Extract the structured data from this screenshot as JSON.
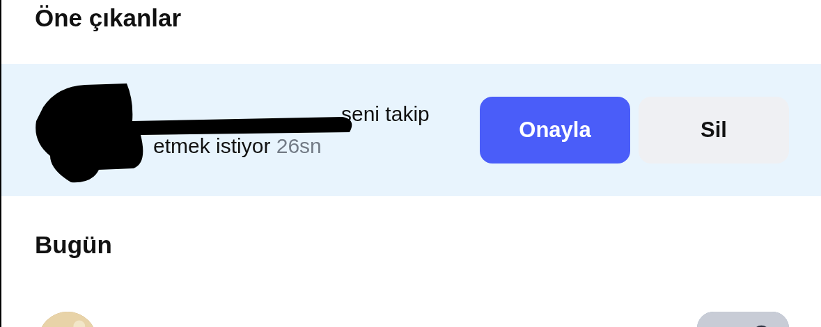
{
  "highlights": {
    "title": "Öne çıkanlar",
    "requests": [
      {
        "text": "seni takip etmek istiyor",
        "time": "26sn",
        "buttons": [
          {
            "label": "Onayla",
            "kind": "primary"
          },
          {
            "label": "Sil",
            "kind": "secondary"
          }
        ]
      }
    ]
  },
  "today": {
    "title": "Bugün",
    "items": [
      {
        "kind": "post"
      }
    ]
  }
}
